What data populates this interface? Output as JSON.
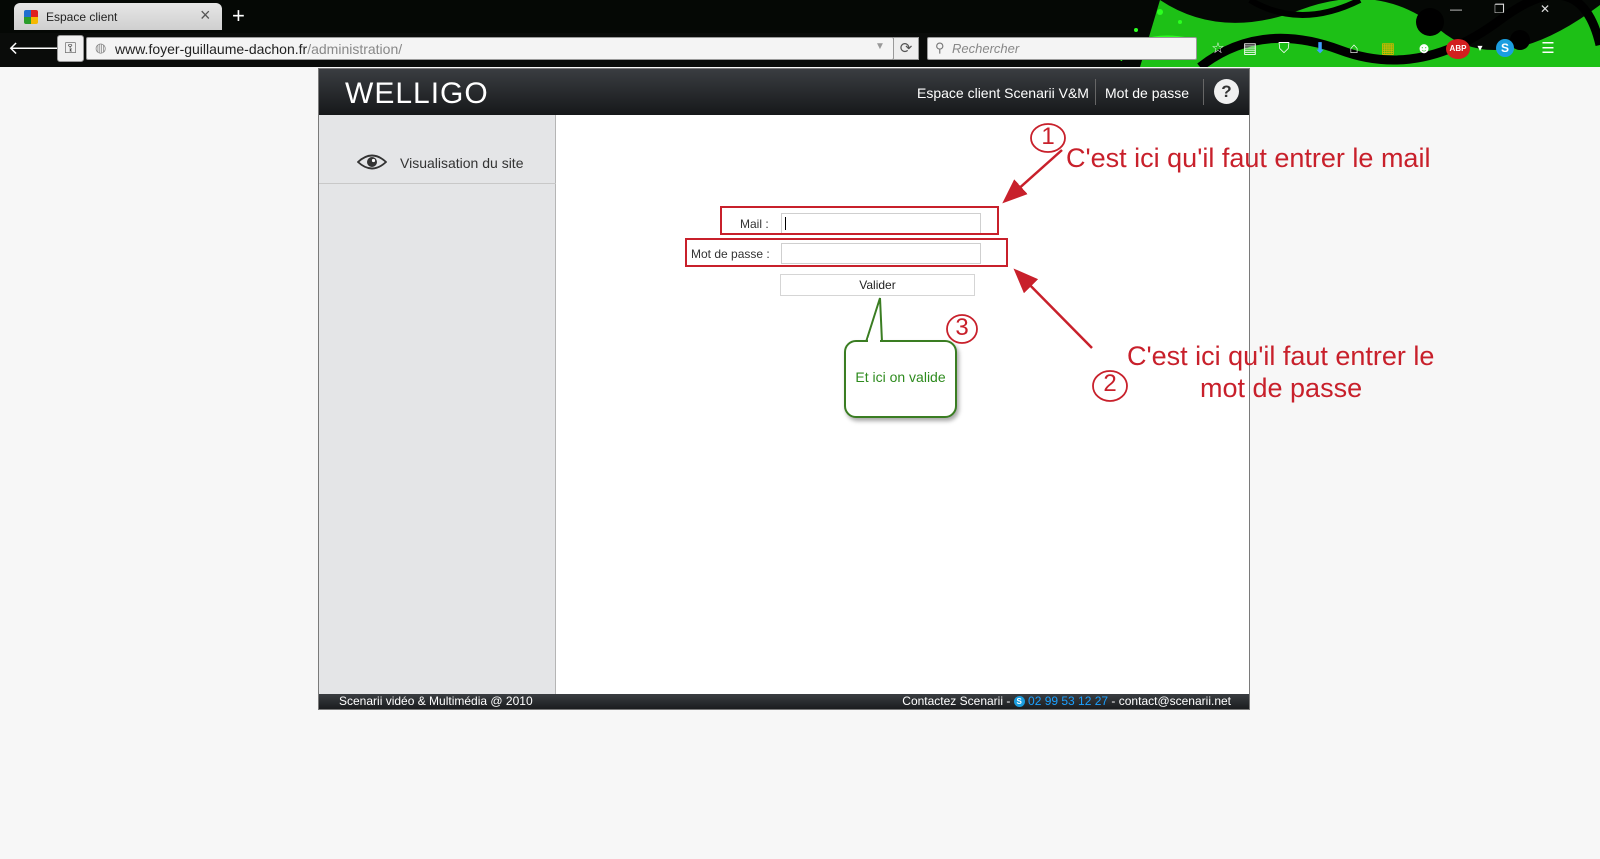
{
  "browser": {
    "tab_title": "Espace client",
    "new_tab": "+",
    "url_host": "www.foyer-guillaume-dachon.fr",
    "url_path": "/administration/",
    "search_placeholder": "Rechercher"
  },
  "header": {
    "logo": "WELLIGO",
    "nav_espace": "Espace client Scenarii V&M",
    "nav_mdp": "Mot de passe",
    "help": "?"
  },
  "sidebar": {
    "items": [
      {
        "label": "Visualisation du site",
        "icon": "eye-icon"
      }
    ]
  },
  "form": {
    "mail_label": "Mail :",
    "mail_value": "",
    "password_label": "Mot de passe :",
    "password_value": "",
    "submit_label": "Valider"
  },
  "footer": {
    "left": "Scenarii vidéo & Multimédia @ 2010",
    "contact_prefix": "Contactez Scenarii - ",
    "skype_icon": "S",
    "phone": "02 99 53 12 27",
    "email": " - contact@scenarii.net"
  },
  "annotations": {
    "n1": "1",
    "text1": "C'est ici qu'il faut entrer le mail",
    "n2": "2",
    "text2_line1": "C'est ici qu'il faut entrer le",
    "text2_line2": "mot de passe",
    "n3": "3",
    "bubble": "Et ici on valide",
    "color_red": "#c8202b",
    "color_green": "#3a7d22"
  }
}
